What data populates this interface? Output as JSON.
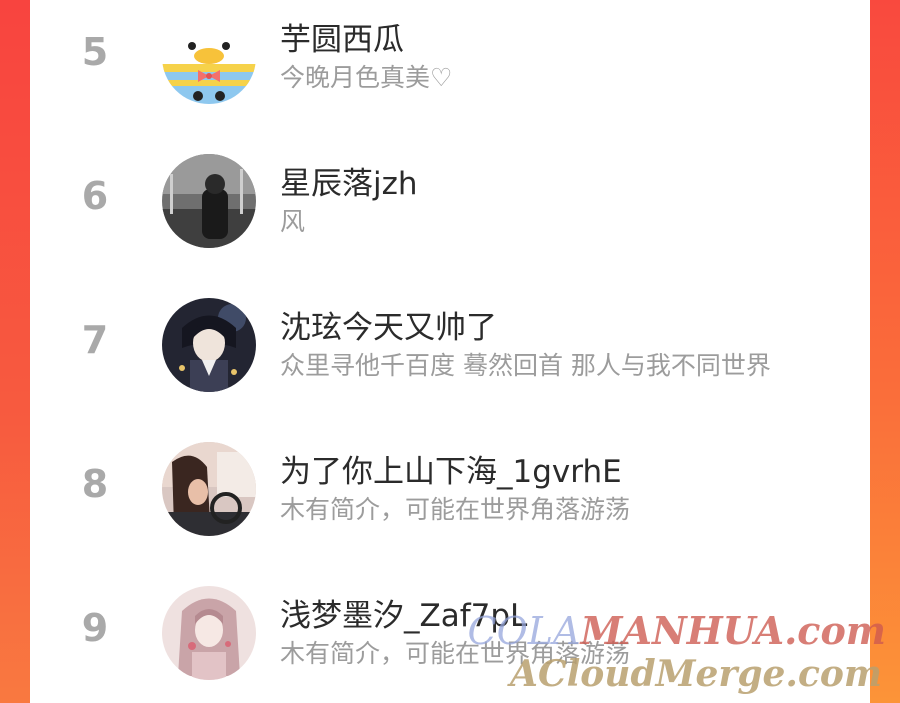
{
  "ranking": [
    {
      "rank": "5",
      "name": "芋圆西瓜",
      "bio": "今晚月色真美♡",
      "avatar": "duck-avatar"
    },
    {
      "rank": "6",
      "name": "星辰落jzh",
      "bio": "风",
      "avatar": "dark-street-avatar"
    },
    {
      "rank": "7",
      "name": "沈玹今天又帅了",
      "bio": "众里寻他千百度 蓦然回首 那人与我不同世界",
      "avatar": "anime-boy-avatar"
    },
    {
      "rank": "8",
      "name": "为了你上山下海_1gvrhE",
      "bio": "木有简介，可能在世界角落游荡",
      "avatar": "car-girl-avatar"
    },
    {
      "rank": "9",
      "name": "浅梦墨汐_Zaf7pL",
      "bio": "木有简介，可能在世界角落游荡",
      "avatar": "pink-girl-avatar"
    }
  ],
  "watermark": {
    "line1_prefix": "COLA",
    "line1_main": "MANHUA.com",
    "line2": "ACloudMerge.com"
  },
  "colors": {
    "background_accent": "#f94d3f",
    "rank_gray": "#a9a9a9",
    "name_text": "#2b2b2b",
    "bio_text": "#9c9c9c"
  }
}
